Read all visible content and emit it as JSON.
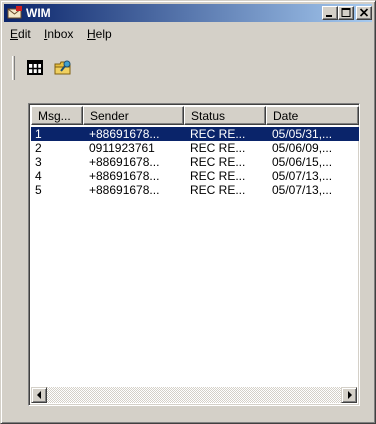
{
  "window": {
    "title": "WIM",
    "colors": {
      "titlebar_start": "#0a246a",
      "titlebar_end": "#a6caf0",
      "selection": "#0a246a",
      "face": "#d4d0c8"
    }
  },
  "icons": {
    "app": "envelope-icon",
    "minimize": "minimize-icon",
    "maximize": "maximize-icon",
    "close": "close-icon",
    "grid": "grid-view-icon",
    "folder": "folder-key-icon",
    "scroll_left": "arrow-left-icon",
    "scroll_right": "arrow-right-icon"
  },
  "menu": {
    "items": [
      {
        "label": "Edit",
        "mnemonic": "E",
        "rest": "dit"
      },
      {
        "label": "Inbox",
        "mnemonic": "I",
        "rest": "nbox"
      },
      {
        "label": "Help",
        "mnemonic": "H",
        "rest": "elp"
      }
    ]
  },
  "list": {
    "columns": [
      "Msg...",
      "Sender",
      "Status",
      "Date"
    ],
    "rows": [
      {
        "msg": "1",
        "sender": "+88691678...",
        "status": "REC RE...",
        "date": "05/05/31,...",
        "selected": true
      },
      {
        "msg": "2",
        "sender": "0911923761",
        "status": "REC RE...",
        "date": "05/06/09,...",
        "selected": false
      },
      {
        "msg": "3",
        "sender": "+88691678...",
        "status": "REC RE...",
        "date": "05/06/15,...",
        "selected": false
      },
      {
        "msg": "4",
        "sender": "+88691678...",
        "status": "REC RE...",
        "date": "05/07/13,...",
        "selected": false
      },
      {
        "msg": "5",
        "sender": "+88691678...",
        "status": "REC RE...",
        "date": "05/07/13,...",
        "selected": false
      }
    ]
  }
}
